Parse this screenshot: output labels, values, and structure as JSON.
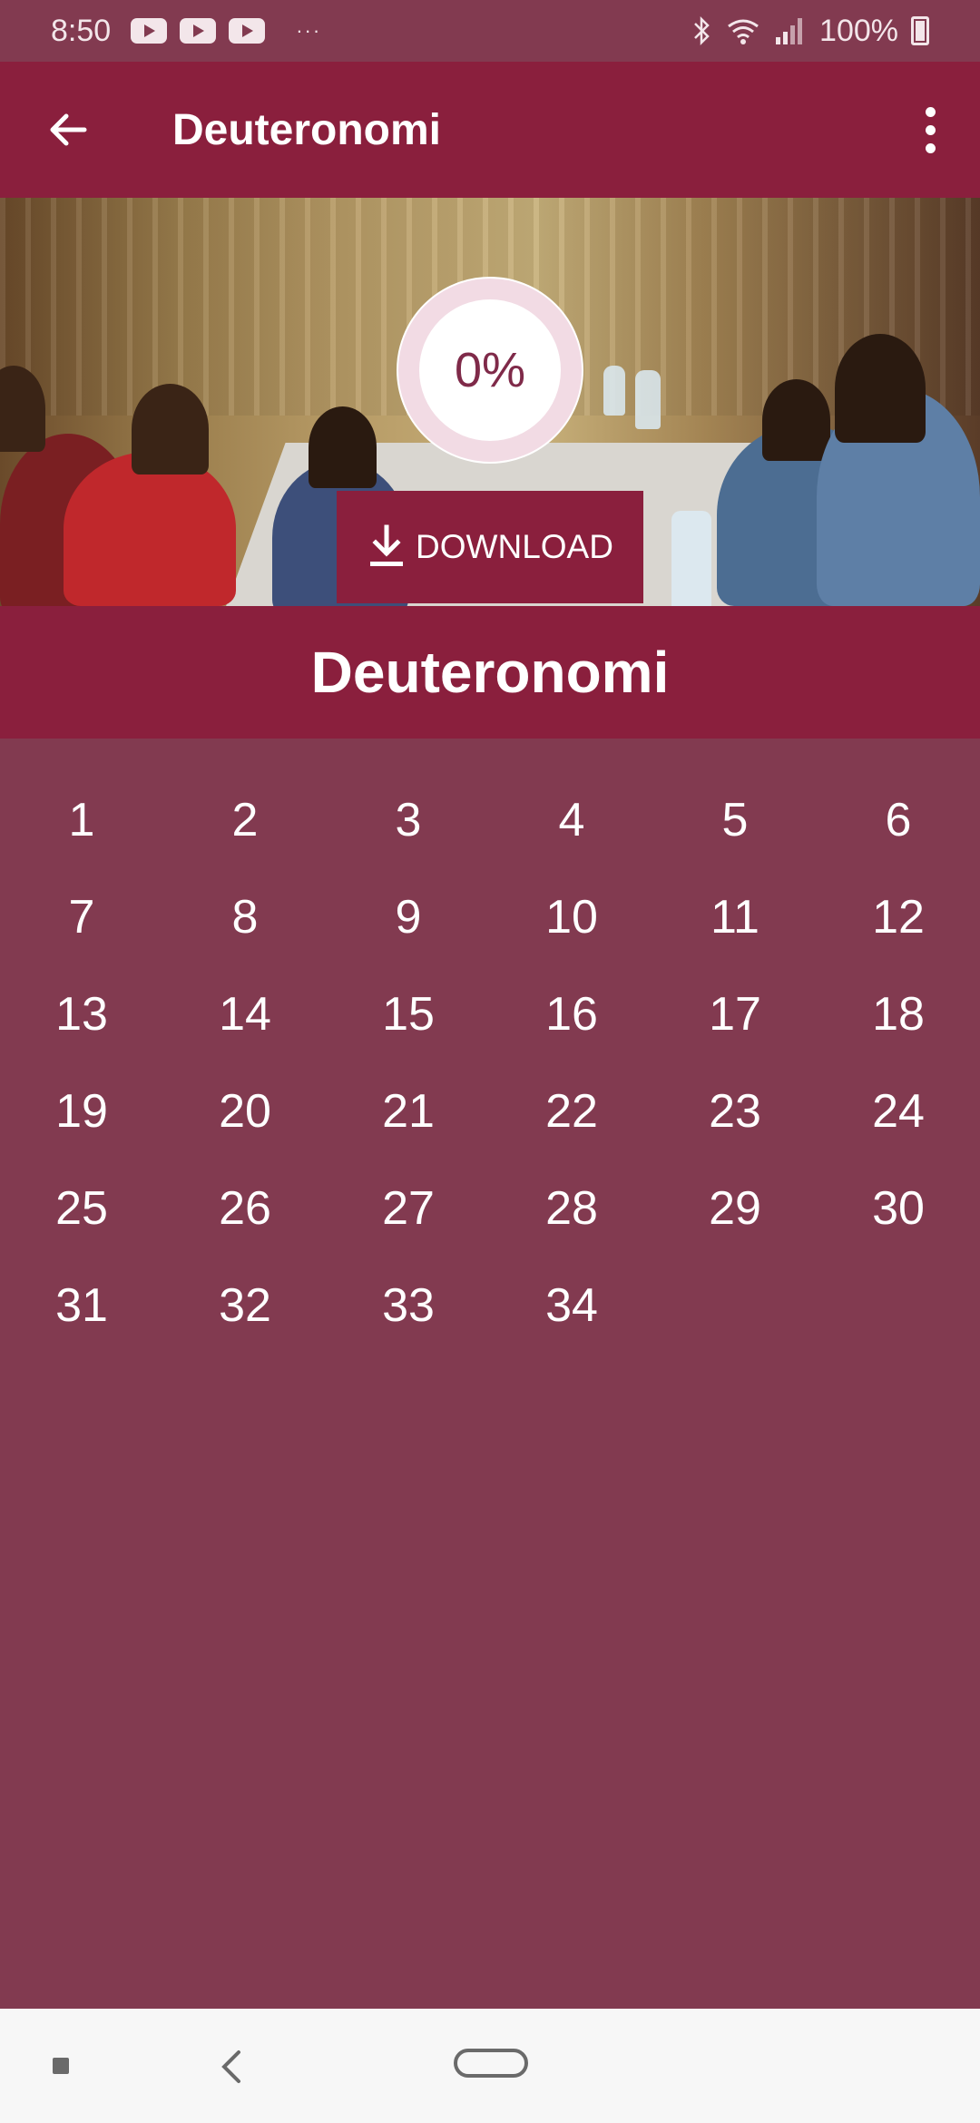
{
  "status_bar": {
    "time": "8:50",
    "notification_icons": [
      "youtube-icon",
      "youtube-icon",
      "youtube-icon"
    ],
    "more_notifications": "···",
    "battery_text": "100%"
  },
  "app_bar": {
    "title": "Deuteronomi",
    "back_icon": "arrow-left-icon",
    "menu_icon": "more-vert-icon"
  },
  "hero": {
    "progress_text": "0%",
    "download_label": "DOWNLOAD"
  },
  "book": {
    "title": "Deuteronomi",
    "chapters": [
      "1",
      "2",
      "3",
      "4",
      "5",
      "6",
      "7",
      "8",
      "9",
      "10",
      "11",
      "12",
      "13",
      "14",
      "15",
      "16",
      "17",
      "18",
      "19",
      "20",
      "21",
      "22",
      "23",
      "24",
      "25",
      "26",
      "27",
      "28",
      "29",
      "30",
      "31",
      "32",
      "33",
      "34"
    ]
  },
  "colors": {
    "primary": "#8a1f3d",
    "background": "#823a50",
    "ring": "#f2dbe4",
    "progress_text": "#7f2a49"
  }
}
